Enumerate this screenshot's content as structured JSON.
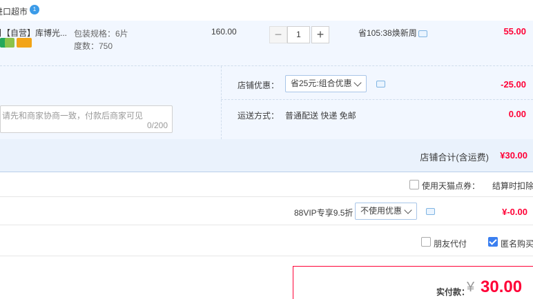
{
  "shop": {
    "name": "进口超市",
    "badge": "1"
  },
  "item": {
    "title": "】【自营】库博光...",
    "spec_label": "包装规格：6片",
    "degree_label": "度数：750",
    "unit_price": "160.00",
    "qty": "1",
    "qty_minus": "−",
    "qty_plus": "+",
    "promo": "省105:38焕新周",
    "price": "55.00"
  },
  "options": {
    "memo_placeholder": "请先和商家协商一致，付款后商家可见",
    "memo_count": "0/200",
    "shop_discount_label": "店铺优惠：",
    "shop_discount_select": "省25元:组合优惠",
    "shop_discount_value": "-25.00",
    "shipping_label": "运送方式：",
    "shipping_value": "普通配送 快递 免邮",
    "shipping_price": "0.00"
  },
  "shop_total": {
    "label": "店铺合计(含运费)",
    "value": "¥30.00"
  },
  "coupon": {
    "label": "使用天猫点券：",
    "note": "结算时扣除"
  },
  "vip": {
    "label": "88VIP专享9.5折",
    "select": "不使用优惠",
    "value": "¥-0.00"
  },
  "extras": {
    "friend_pay": "朋友代付",
    "anonymous": "匿名购买"
  },
  "payment": {
    "label": "实付款：",
    "yen": "¥",
    "amount": "30.00"
  }
}
